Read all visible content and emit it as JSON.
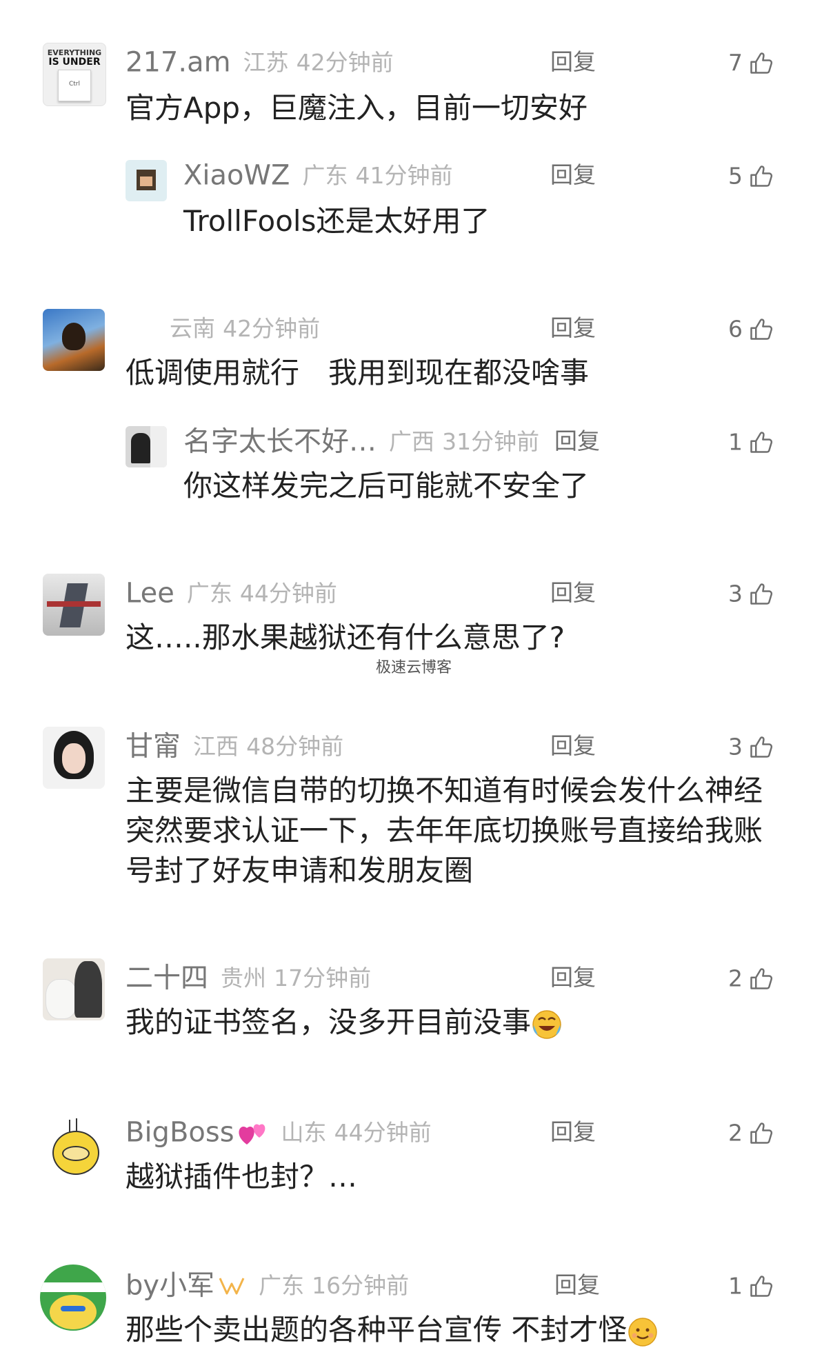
{
  "reply_label": "回复",
  "watermark": "极速云博客",
  "comments": [
    {
      "name": "217.am",
      "location": "江苏",
      "time": "42分钟前",
      "likes": "7",
      "text": "官方App，巨魔注入，目前一切安好",
      "avatar_text": [
        "EVERYTHING",
        "IS UNDER",
        "Ctrl"
      ],
      "replies": [
        {
          "name": "XiaoWZ",
          "location": "广东",
          "time": "41分钟前",
          "likes": "5",
          "text": "TrollFools还是太好用了"
        }
      ]
    },
    {
      "name": "",
      "location": "云南",
      "time": "42分钟前",
      "likes": "6",
      "text": "低调使用就行　我用到现在都没啥事",
      "replies": [
        {
          "name": "名字太长不好…",
          "location": "广西",
          "time": "31分钟前",
          "likes": "1",
          "text": "你这样发完之后可能就不安全了"
        }
      ]
    },
    {
      "name": "Lee",
      "location": "广东",
      "time": "44分钟前",
      "likes": "3",
      "text": "这…..那水果越狱还有什么意思了?"
    },
    {
      "name": "甘甯",
      "location": "江西",
      "time": "48分钟前",
      "likes": "3",
      "text": "主要是微信自带的切换不知道有时候会发什么神经突然要求认证一下，去年年底切换账号直接给我账号封了好友申请和发朋友圈"
    },
    {
      "name": "二十四",
      "location": "贵州",
      "time": "17分钟前",
      "likes": "2",
      "text": "我的证书签名，没多开目前没事"
    },
    {
      "name": "BigBoss",
      "location": "山东",
      "time": "44分钟前",
      "likes": "2",
      "text": "越狱插件也封？…"
    },
    {
      "name": "by小军",
      "location": "广东",
      "time": "16分钟前",
      "likes": "1",
      "text": "那些个卖出题的各种平台宣传 不封才怪"
    }
  ]
}
